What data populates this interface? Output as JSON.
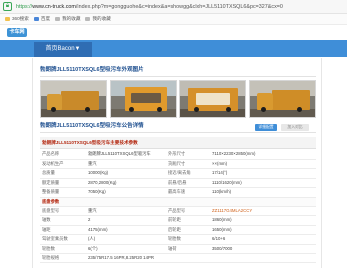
{
  "browser": {
    "url_scheme": "https://",
    "url_domain": "www.cn-truck.com",
    "url_rest": "/index.php?m=gongguohe&c=index&a=showgg&clxh=JLL5110TXSQL6&pc=327&cx=0",
    "bookmarks": [
      {
        "label": "360搜索",
        "icon": "bookmark-icon"
      },
      {
        "label": "百度",
        "icon": "bookmark-icon"
      },
      {
        "label": "我的收藏",
        "icon": "folder-icon"
      },
      {
        "label": "我的收藏",
        "icon": "folder-icon"
      }
    ]
  },
  "site": {
    "logo_text": "卡车网",
    "nav_tab": "首页Bacon▼"
  },
  "section_images_title": "勃朗牌JLL5110TXSQL6型吸污车外观图片",
  "section_specs_title": "勃朗牌JLL5110TXSQL6型吸污车公告详情",
  "spec": {
    "buttons": {
      "query": "详细配置",
      "compare": "加入对比"
    },
    "table_title": "勃朗牌JLL5110TXSQL6型吸污车主要技术参数",
    "rows": [
      [
        "产品名称",
        "勃朗牌JLL5110TXSQL6型吸污车",
        "外形尺寸",
        "7110×2230×2850(mm)"
      ],
      [
        "发动机生产",
        "重汽",
        "货厢尺寸",
        "××(mm)"
      ],
      [
        "总质量",
        "10000(Kg)",
        "接近/离去角",
        "17/14(°)"
      ],
      [
        "额定质量",
        "2870,2800(Kg)",
        "前悬/后悬",
        "1110/1620(mm)"
      ],
      [
        "整备质量",
        "7050(Kg)",
        "最高车速",
        "110(km/h)"
      ]
    ],
    "chassis_title": "底盘参数",
    "chassis_rows": [
      [
        "底盘型号",
        "重汽",
        "产品型号",
        "ZZ1117G4MLA2CCY"
      ],
      [
        "轴数",
        "2",
        "前轮距",
        "1860(mm)"
      ],
      [
        "轴距",
        "4175(mm)",
        "后轮距",
        "1650(mm)"
      ],
      [
        "驾驶室乘员数",
        "(人)",
        "轮胎数",
        "6/10+6"
      ],
      [
        "轮胎数",
        "6(个)",
        "轴荷",
        "3500/7000"
      ],
      [
        "轮胎规格",
        "235/75R17.5 16PR,8.25R20 14PR",
        "",
        ""
      ]
    ]
  },
  "colors": {
    "brand_blue": "#3f8ed8",
    "accent_red": "#b3260e"
  }
}
